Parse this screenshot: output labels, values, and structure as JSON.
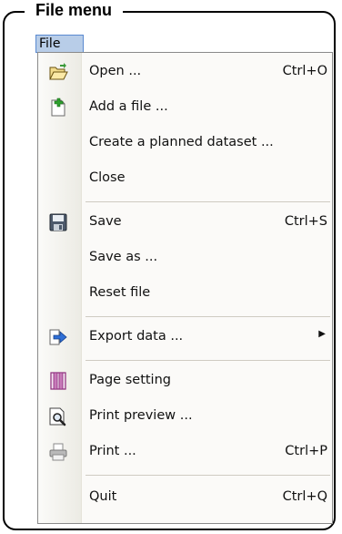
{
  "frame": {
    "title": "File menu"
  },
  "menubar": {
    "file_label": "File"
  },
  "menu": {
    "items": [
      {
        "label": "Open ...",
        "shortcut": "Ctrl+O",
        "icon": "folder-open-icon"
      },
      {
        "label": "Add a file ...",
        "shortcut": "",
        "icon": "add-file-icon"
      },
      {
        "label": "Create a planned dataset ...",
        "shortcut": ""
      },
      {
        "label": "Close",
        "shortcut": ""
      },
      {
        "label": "Save",
        "shortcut": "Ctrl+S",
        "icon": "floppy-disk-icon"
      },
      {
        "label": "Save as ...",
        "shortcut": ""
      },
      {
        "label": "Reset file",
        "shortcut": ""
      },
      {
        "label": "Export data ...",
        "shortcut": "",
        "icon": "export-arrow-icon",
        "submenu": true
      },
      {
        "label": "Page setting",
        "shortcut": "",
        "icon": "page-setting-icon"
      },
      {
        "label": "Print preview ...",
        "shortcut": "",
        "icon": "print-preview-icon"
      },
      {
        "label": "Print ...",
        "shortcut": "Ctrl+P",
        "icon": "printer-icon"
      },
      {
        "label": "Quit",
        "shortcut": "Ctrl+Q"
      }
    ]
  },
  "colors": {
    "menubar_highlight": "#b8cde8",
    "menu_background": "#fbfaf8",
    "frame": "#000000"
  }
}
